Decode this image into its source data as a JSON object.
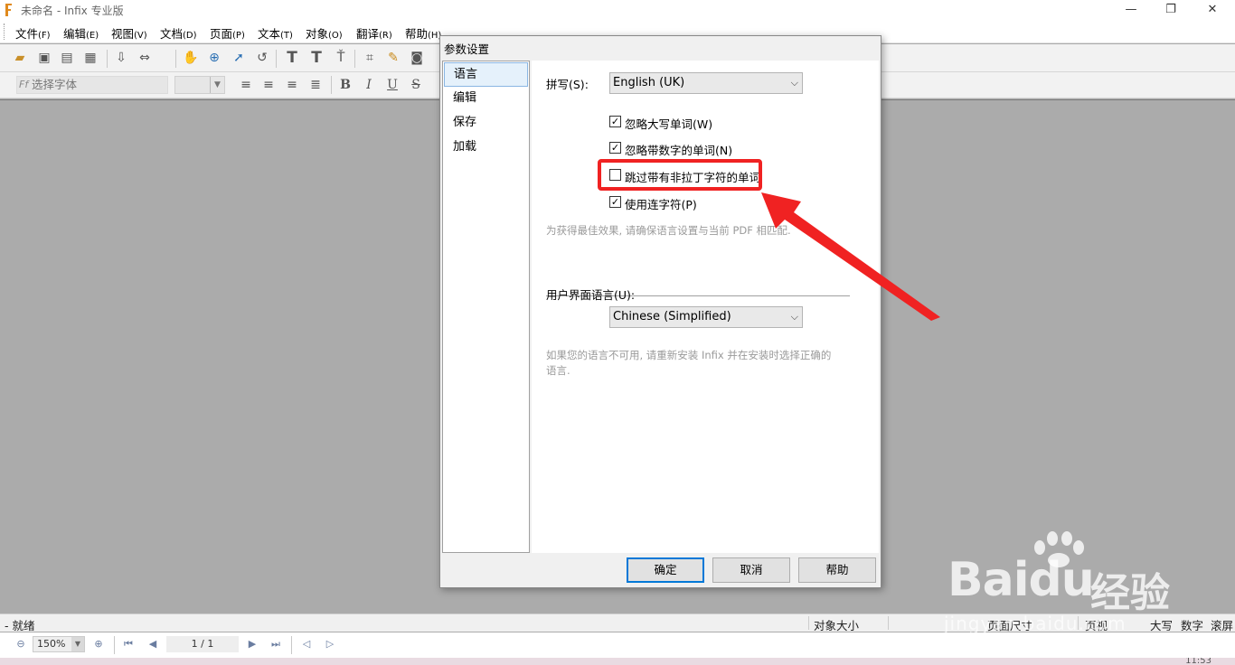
{
  "window": {
    "title": "未命名 - Infix 专业版",
    "minimize_glyph": "—",
    "restore_glyph": "❐",
    "close_glyph": "✕"
  },
  "menu": [
    {
      "label": "文件",
      "key": "(F)"
    },
    {
      "label": "编辑",
      "key": "(E)"
    },
    {
      "label": "视图",
      "key": "(V)"
    },
    {
      "label": "文档",
      "key": "(D)"
    },
    {
      "label": "页面",
      "key": "(P)"
    },
    {
      "label": "文本",
      "key": "(T)"
    },
    {
      "label": "对象",
      "key": "(O)"
    },
    {
      "label": "翻译",
      "key": "(R)"
    },
    {
      "label": "帮助",
      "key": "(H)"
    }
  ],
  "toolbar": {
    "icons": [
      "open-folder-icon",
      "save-icon",
      "save-as-icon",
      "print-icon",
      "import-icon",
      "export-icon",
      "hand-tool-icon",
      "zoom-icon",
      "select-arrow-icon",
      "rotate-icon",
      "text-tool-icon",
      "text-edit-icon",
      "text-flow-icon",
      "crop-icon",
      "link-icon",
      "camera-icon"
    ],
    "font_placeholder": "选择字体",
    "font_glyph": "Ff",
    "format_icons": [
      "align-left-icon",
      "align-center-icon",
      "align-right-icon",
      "justify-icon",
      "bold-icon",
      "italic-icon",
      "underline-icon",
      "strikethrough-icon"
    ]
  },
  "status": {
    "ready": "就绪",
    "object_size": "对象大小",
    "page_size": "页面尺寸",
    "view": "页视",
    "caps": "大写",
    "num": "数字",
    "scroll": "滚屏"
  },
  "nav": {
    "zoom_value": "150%",
    "page_value": "1 / 1",
    "clock": "11:53"
  },
  "dialog": {
    "title": "参数设置",
    "categories": [
      "语言",
      "编辑",
      "保存",
      "加载"
    ],
    "selected_category": "语言",
    "spelling_label": "拼写(S):",
    "spelling_value": "English (UK)",
    "options": [
      {
        "label": "忽略大写单词(W)",
        "checked": true
      },
      {
        "label": "忽略带数字的单词(N)",
        "checked": true
      },
      {
        "label": "跳过带有非拉丁字符的单词",
        "checked": false
      },
      {
        "label": "使用连字符(P)",
        "checked": true
      }
    ],
    "spelling_hint": "为获得最佳效果, 请确保语言设置与当前 PDF 相匹配.",
    "ui_language_label": "用户界面语言(U):",
    "ui_language_value": "Chinese (Simplified)",
    "ui_language_hint_line1": "如果您的语言不可用, 请重新安装 Infix 并在安装时选择正确的",
    "ui_language_hint_line2": "语言.",
    "buttons": {
      "ok": "确定",
      "cancel": "取消",
      "help": "帮助"
    }
  },
  "watermark": {
    "brand": "Baidu",
    "brand_cn": "经验",
    "url": "jingyan.baidu.com"
  },
  "colors": {
    "highlight": "#f02222",
    "selected_bg": "#e5f1fb",
    "default_button_border": "#0078d7"
  }
}
